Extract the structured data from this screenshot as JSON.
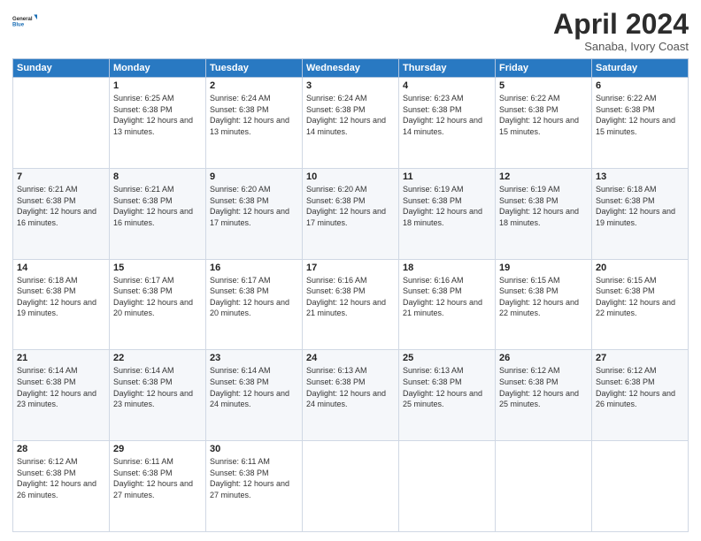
{
  "header": {
    "logo_line1": "General",
    "logo_line2": "Blue",
    "month": "April 2024",
    "location": "Sanaba, Ivory Coast"
  },
  "days_of_week": [
    "Sunday",
    "Monday",
    "Tuesday",
    "Wednesday",
    "Thursday",
    "Friday",
    "Saturday"
  ],
  "weeks": [
    [
      {
        "day": "",
        "sunrise": "",
        "sunset": "",
        "daylight": ""
      },
      {
        "day": "1",
        "sunrise": "6:25 AM",
        "sunset": "6:38 PM",
        "daylight": "12 hours and 13 minutes."
      },
      {
        "day": "2",
        "sunrise": "6:24 AM",
        "sunset": "6:38 PM",
        "daylight": "12 hours and 13 minutes."
      },
      {
        "day": "3",
        "sunrise": "6:24 AM",
        "sunset": "6:38 PM",
        "daylight": "12 hours and 14 minutes."
      },
      {
        "day": "4",
        "sunrise": "6:23 AM",
        "sunset": "6:38 PM",
        "daylight": "12 hours and 14 minutes."
      },
      {
        "day": "5",
        "sunrise": "6:22 AM",
        "sunset": "6:38 PM",
        "daylight": "12 hours and 15 minutes."
      },
      {
        "day": "6",
        "sunrise": "6:22 AM",
        "sunset": "6:38 PM",
        "daylight": "12 hours and 15 minutes."
      }
    ],
    [
      {
        "day": "7",
        "sunrise": "6:21 AM",
        "sunset": "6:38 PM",
        "daylight": "12 hours and 16 minutes."
      },
      {
        "day": "8",
        "sunrise": "6:21 AM",
        "sunset": "6:38 PM",
        "daylight": "12 hours and 16 minutes."
      },
      {
        "day": "9",
        "sunrise": "6:20 AM",
        "sunset": "6:38 PM",
        "daylight": "12 hours and 17 minutes."
      },
      {
        "day": "10",
        "sunrise": "6:20 AM",
        "sunset": "6:38 PM",
        "daylight": "12 hours and 17 minutes."
      },
      {
        "day": "11",
        "sunrise": "6:19 AM",
        "sunset": "6:38 PM",
        "daylight": "12 hours and 18 minutes."
      },
      {
        "day": "12",
        "sunrise": "6:19 AM",
        "sunset": "6:38 PM",
        "daylight": "12 hours and 18 minutes."
      },
      {
        "day": "13",
        "sunrise": "6:18 AM",
        "sunset": "6:38 PM",
        "daylight": "12 hours and 19 minutes."
      }
    ],
    [
      {
        "day": "14",
        "sunrise": "6:18 AM",
        "sunset": "6:38 PM",
        "daylight": "12 hours and 19 minutes."
      },
      {
        "day": "15",
        "sunrise": "6:17 AM",
        "sunset": "6:38 PM",
        "daylight": "12 hours and 20 minutes."
      },
      {
        "day": "16",
        "sunrise": "6:17 AM",
        "sunset": "6:38 PM",
        "daylight": "12 hours and 20 minutes."
      },
      {
        "day": "17",
        "sunrise": "6:16 AM",
        "sunset": "6:38 PM",
        "daylight": "12 hours and 21 minutes."
      },
      {
        "day": "18",
        "sunrise": "6:16 AM",
        "sunset": "6:38 PM",
        "daylight": "12 hours and 21 minutes."
      },
      {
        "day": "19",
        "sunrise": "6:15 AM",
        "sunset": "6:38 PM",
        "daylight": "12 hours and 22 minutes."
      },
      {
        "day": "20",
        "sunrise": "6:15 AM",
        "sunset": "6:38 PM",
        "daylight": "12 hours and 22 minutes."
      }
    ],
    [
      {
        "day": "21",
        "sunrise": "6:14 AM",
        "sunset": "6:38 PM",
        "daylight": "12 hours and 23 minutes."
      },
      {
        "day": "22",
        "sunrise": "6:14 AM",
        "sunset": "6:38 PM",
        "daylight": "12 hours and 23 minutes."
      },
      {
        "day": "23",
        "sunrise": "6:14 AM",
        "sunset": "6:38 PM",
        "daylight": "12 hours and 24 minutes."
      },
      {
        "day": "24",
        "sunrise": "6:13 AM",
        "sunset": "6:38 PM",
        "daylight": "12 hours and 24 minutes."
      },
      {
        "day": "25",
        "sunrise": "6:13 AM",
        "sunset": "6:38 PM",
        "daylight": "12 hours and 25 minutes."
      },
      {
        "day": "26",
        "sunrise": "6:12 AM",
        "sunset": "6:38 PM",
        "daylight": "12 hours and 25 minutes."
      },
      {
        "day": "27",
        "sunrise": "6:12 AM",
        "sunset": "6:38 PM",
        "daylight": "12 hours and 26 minutes."
      }
    ],
    [
      {
        "day": "28",
        "sunrise": "6:12 AM",
        "sunset": "6:38 PM",
        "daylight": "12 hours and 26 minutes."
      },
      {
        "day": "29",
        "sunrise": "6:11 AM",
        "sunset": "6:38 PM",
        "daylight": "12 hours and 27 minutes."
      },
      {
        "day": "30",
        "sunrise": "6:11 AM",
        "sunset": "6:38 PM",
        "daylight": "12 hours and 27 minutes."
      },
      {
        "day": "",
        "sunrise": "",
        "sunset": "",
        "daylight": ""
      },
      {
        "day": "",
        "sunrise": "",
        "sunset": "",
        "daylight": ""
      },
      {
        "day": "",
        "sunrise": "",
        "sunset": "",
        "daylight": ""
      },
      {
        "day": "",
        "sunrise": "",
        "sunset": "",
        "daylight": ""
      }
    ]
  ],
  "labels": {
    "sunrise": "Sunrise:",
    "sunset": "Sunset:",
    "daylight": "Daylight:"
  }
}
